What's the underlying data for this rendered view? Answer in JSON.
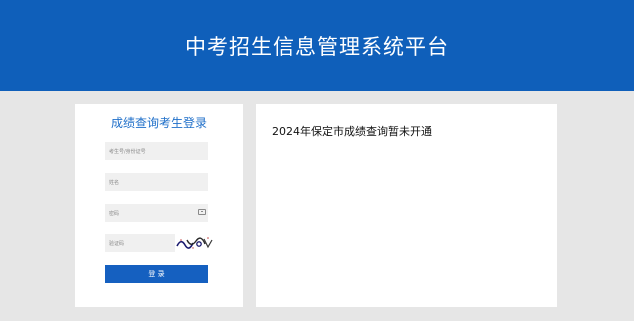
{
  "header": {
    "title": "中考招生信息管理系统平台"
  },
  "login": {
    "title": "成绩查询考生登录",
    "exam_id_placeholder": "考生号/身份证号",
    "name_placeholder": "姓名",
    "password_placeholder": "密码",
    "captcha_placeholder": "验证码",
    "submit_label": "登 录"
  },
  "notice": {
    "text": "2024年保定市成绩查询暂未开通"
  },
  "colors": {
    "header_bg": "#0f5fba",
    "accent": "#1f6fc9",
    "button_bg": "#1560c0",
    "page_bg": "#e6e6e6"
  }
}
